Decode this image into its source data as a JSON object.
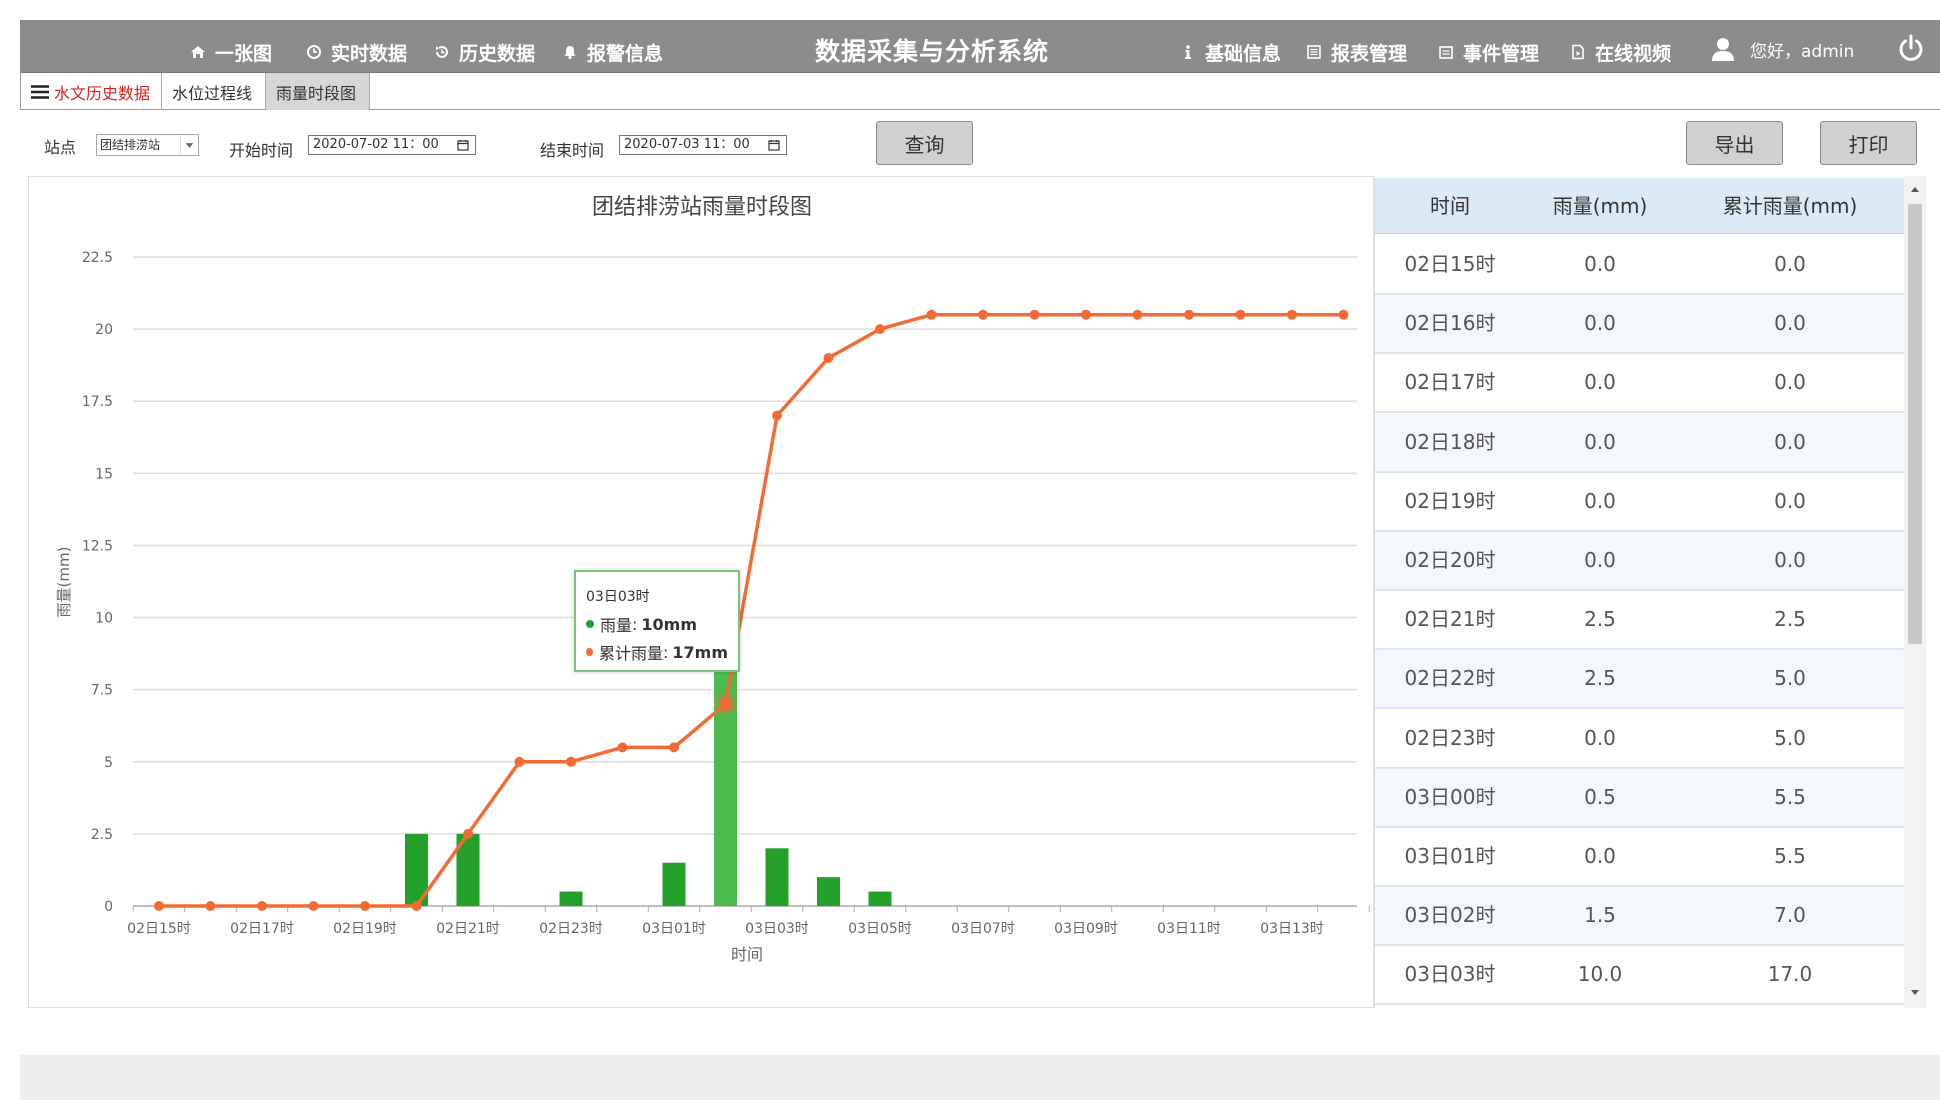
{
  "header": {
    "title": "数据采集与分析系统",
    "nav_left": [
      {
        "label": "一张图",
        "icon": "home-icon"
      },
      {
        "label": "实时数据",
        "icon": "clock-icon"
      },
      {
        "label": "历史数据",
        "icon": "history-icon"
      },
      {
        "label": "报警信息",
        "icon": "bell-icon"
      }
    ],
    "nav_right": [
      {
        "label": "基础信息",
        "icon": "info-icon"
      },
      {
        "label": "报表管理",
        "icon": "report-icon"
      },
      {
        "label": "事件管理",
        "icon": "event-icon"
      },
      {
        "label": "在线视频",
        "icon": "video-icon"
      }
    ],
    "user_greeting": "您好，admin",
    "user_icon": "user-icon",
    "power_icon": "power-icon"
  },
  "tabs": [
    {
      "label": "水文历史数据",
      "icon": "menu-icon"
    },
    {
      "label": "水位过程线"
    },
    {
      "label": "雨量时段图"
    }
  ],
  "filters": {
    "station_label": "站点",
    "station_value": "团结排涝站",
    "start_label": "开始时间",
    "start_value": "2020-07-02 11：00",
    "end_label": "结束时间",
    "end_value": "2020-07-03 11：00",
    "query_label": "查询",
    "export_label": "导出",
    "print_label": "打印"
  },
  "colors": {
    "topbar": "#8c8c8c",
    "bar": "#22a02a",
    "bar_highlight": "#4cbd4c",
    "line": "#f26b35",
    "table_header": "#dce9f6"
  },
  "chart_data": {
    "type": "bar+line",
    "title": "团结排涝站雨量时段图",
    "xlabel": "时间",
    "ylabel": "雨量(mm)",
    "ylim": [
      0,
      22.5
    ],
    "yticks": [
      0,
      2.5,
      5,
      7.5,
      10,
      12.5,
      15,
      17.5,
      20,
      22.5
    ],
    "categories": [
      "02日15时",
      "02日16时",
      "02日17时",
      "02日18时",
      "02日19时",
      "02日20时",
      "02日21时",
      "02日22时",
      "02日23时",
      "03日00时",
      "03日01时",
      "03日02时",
      "03日03时",
      "03日04时",
      "03日05时",
      "03日06时",
      "03日07时",
      "03日08时",
      "03日09时",
      "03日10时",
      "03日11时",
      "03日12时",
      "03日13时",
      "03日14时"
    ],
    "xtick_labels": [
      "02日15时",
      "02日17时",
      "02日19时",
      "02日21时",
      "02日23时",
      "03日01时",
      "03日03时",
      "03日05时",
      "03日07时",
      "03日09时",
      "03日11时",
      "03日13时"
    ],
    "grid": true,
    "series": [
      {
        "name": "雨量",
        "type": "bar",
        "values": [
          0,
          0,
          0,
          0,
          0,
          2.5,
          2.5,
          0,
          0.5,
          0,
          1.5,
          10,
          2,
          1,
          0.5,
          0,
          0,
          0,
          0,
          0,
          0,
          0,
          0,
          0
        ]
      },
      {
        "name": "累计雨量",
        "type": "line",
        "values": [
          0,
          0,
          0,
          0,
          0,
          0,
          2.5,
          5,
          5,
          5.5,
          5.5,
          7,
          17,
          19,
          20,
          20.5,
          20.5,
          20.5,
          20.5,
          20.5,
          20.5,
          20.5,
          20.5,
          20.5
        ]
      }
    ],
    "tooltip": {
      "title": "03日03时",
      "rows": [
        {
          "name": "雨量",
          "value": "10mm"
        },
        {
          "name": "累计雨量",
          "value": "17mm"
        }
      ]
    }
  },
  "table": {
    "headers": [
      "时间",
      "雨量(mm)",
      "累计雨量(mm)"
    ],
    "rows": [
      [
        "02日15时",
        "0.0",
        "0.0"
      ],
      [
        "02日16时",
        "0.0",
        "0.0"
      ],
      [
        "02日17时",
        "0.0",
        "0.0"
      ],
      [
        "02日18时",
        "0.0",
        "0.0"
      ],
      [
        "02日19时",
        "0.0",
        "0.0"
      ],
      [
        "02日20时",
        "0.0",
        "0.0"
      ],
      [
        "02日21时",
        "2.5",
        "2.5"
      ],
      [
        "02日22时",
        "2.5",
        "5.0"
      ],
      [
        "02日23时",
        "0.0",
        "5.0"
      ],
      [
        "03日00时",
        "0.5",
        "5.5"
      ],
      [
        "03日01时",
        "0.0",
        "5.5"
      ],
      [
        "03日02时",
        "1.5",
        "7.0"
      ],
      [
        "03日03时",
        "10.0",
        "17.0"
      ]
    ]
  }
}
